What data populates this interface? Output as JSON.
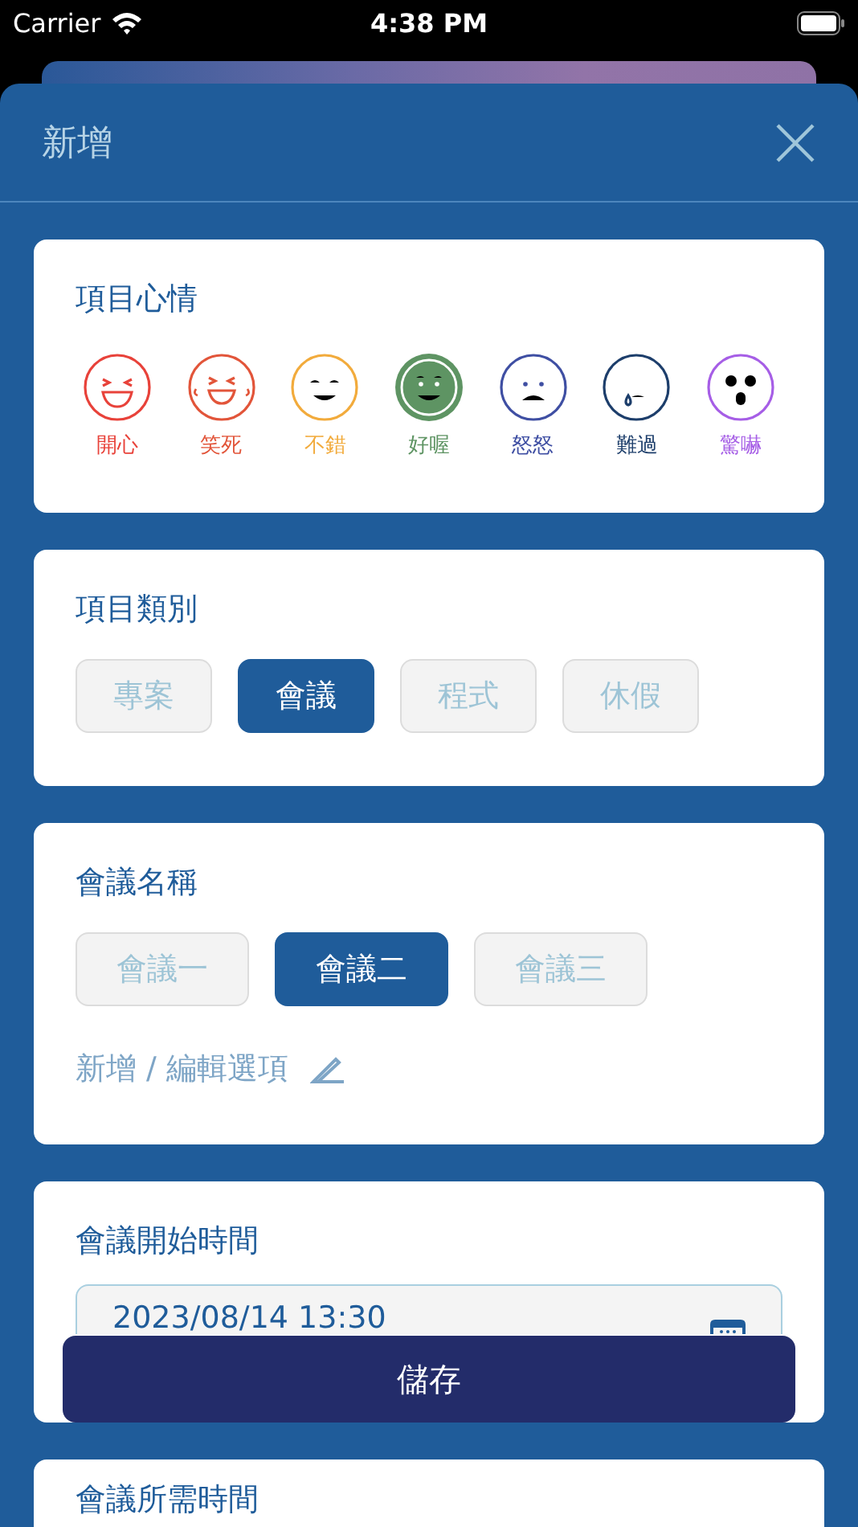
{
  "status_bar": {
    "carrier": "Carrier",
    "time": "4:38 PM"
  },
  "sheet": {
    "title": "新增"
  },
  "mood": {
    "title": "項目心情",
    "items": [
      {
        "label": "開心",
        "kind": "grin",
        "color": "#e8423a",
        "selected": false
      },
      {
        "label": "笑死",
        "kind": "laugh",
        "color": "#e2553a",
        "selected": false
      },
      {
        "label": "不錯",
        "kind": "smile",
        "color": "#f2ab3c",
        "selected": false
      },
      {
        "label": "好喔",
        "kind": "content",
        "color": "#5e9463",
        "selected": true
      },
      {
        "label": "怒怒",
        "kind": "angry",
        "color": "#3f4fa3",
        "selected": false
      },
      {
        "label": "難過",
        "kind": "sad",
        "color": "#1d3e6b",
        "selected": false
      },
      {
        "label": "驚嚇",
        "kind": "shock",
        "color": "#a65ee6",
        "selected": false
      }
    ]
  },
  "category": {
    "title": "項目類別",
    "options": [
      {
        "label": "專案",
        "selected": false
      },
      {
        "label": "會議",
        "selected": true
      },
      {
        "label": "程式",
        "selected": false
      },
      {
        "label": "休假",
        "selected": false
      }
    ]
  },
  "meeting_name": {
    "title": "會議名稱",
    "options": [
      {
        "label": "會議一",
        "selected": false
      },
      {
        "label": "會議二",
        "selected": true
      },
      {
        "label": "會議三",
        "selected": false
      }
    ],
    "edit_link": "新增 / 編輯選項"
  },
  "start_time": {
    "title": "會議開始時間",
    "value": "2023/08/14 13:30"
  },
  "duration": {
    "title": "會議所需時間"
  },
  "save_button": "儲存"
}
